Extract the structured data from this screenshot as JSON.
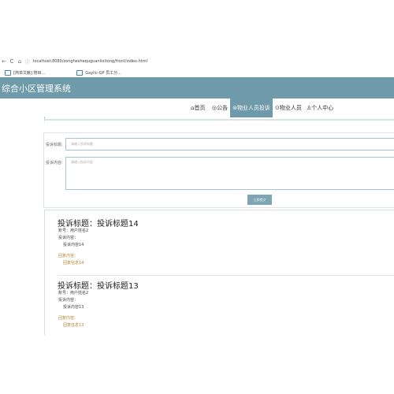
{
  "browser": {
    "back": "←",
    "refresh": "C",
    "home": "⌂",
    "url": "localhost:8080/zongheshequguanlixitong/front/index.html"
  },
  "bookmarks": [
    {
      "label": "[简单文献] 搜目..."
    },
    {
      "label": "Gayllc-GP 员工分..."
    }
  ],
  "site": {
    "title": "综合小区管理系统"
  },
  "nav": {
    "items": [
      {
        "icon": "⌂",
        "label": "首页"
      },
      {
        "icon": "◎",
        "label": "公告"
      },
      {
        "icon": "⊜",
        "label": "物业人员投诉"
      },
      {
        "icon": "⊙",
        "label": "物业人员"
      },
      {
        "icon": "♙",
        "label": "个人中心"
      }
    ]
  },
  "form": {
    "title_label": "投诉标题:",
    "title_placeholder": "请输入投诉标题",
    "content_label": "投诉内容:",
    "content_placeholder": "请输入投诉内容",
    "submit_label": "立即提交"
  },
  "complaints": [
    {
      "title": "投诉标题：投诉标题14",
      "account_line": "账号：用户姓名2",
      "content_label": "投诉内容：",
      "content": "投诉内容14",
      "reply_label": "回复内容：",
      "reply": "回复信息14"
    },
    {
      "title": "投诉标题：投诉标题13",
      "account_line": "账号：用户姓名2",
      "content_label": "投诉内容：",
      "content": "投诉内容13",
      "reply_label": "回复内容：",
      "reply": "回复信息13"
    }
  ],
  "colors": {
    "header": "#6e9aaa",
    "accent": "#7ea5b4",
    "reply": "#b5862f"
  }
}
